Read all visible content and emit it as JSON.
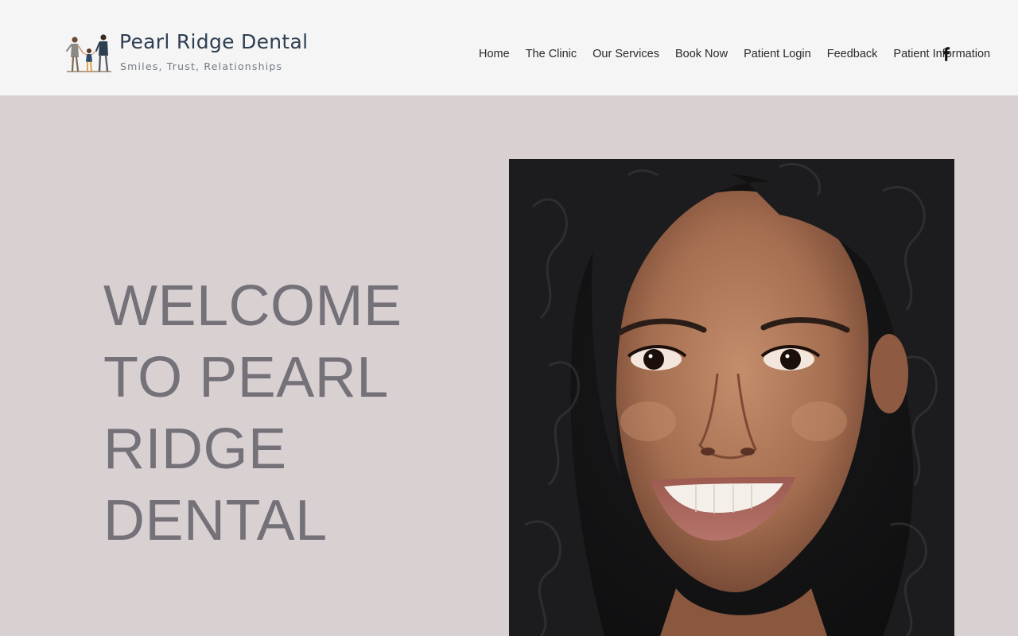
{
  "header": {
    "brand_name": "Pearl Ridge Dental",
    "tagline": "Smiles, Trust, Relationships",
    "logo_icon": "family-walking-icon",
    "nav": [
      {
        "label": "Home"
      },
      {
        "label": "The Clinic"
      },
      {
        "label": "Our Services"
      },
      {
        "label": "Book Now"
      },
      {
        "label": "Patient Login"
      },
      {
        "label": "Feedback"
      },
      {
        "label": "Patient Information"
      }
    ],
    "social_icon": "facebook-icon"
  },
  "hero": {
    "title": "WELCOME TO PEARL RIDGE DENTAL",
    "image_subject": "smiling-woman-portrait"
  },
  "colors": {
    "header_bg": "#f5f5f5",
    "page_bg": "#d9d0d2",
    "brand_text": "#2f3f52",
    "hero_text": "#747179"
  }
}
